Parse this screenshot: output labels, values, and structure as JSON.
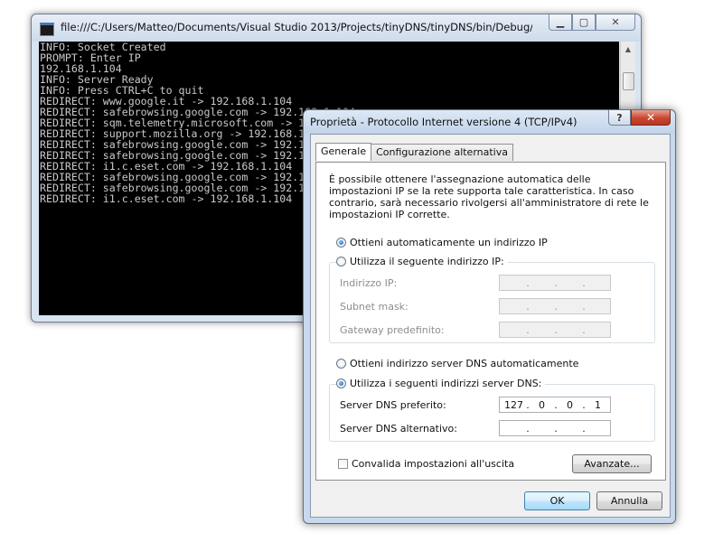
{
  "console": {
    "title": "file:///C:/Users/Matteo/Documents/Visual Studio 2013/Projects/tinyDNS/tinyDNS/bin/Debug/tiny...",
    "minimize_icon": "minimize-icon",
    "maximize_icon": "maximize-icon",
    "close_icon": "close-icon",
    "lines": [
      "INFO: Socket Created",
      "PROMPT: Enter IP",
      "192.168.1.104",
      "INFO: Server Ready",
      "INFO: Press CTRL+C to quit",
      "REDIRECT: www.google.it -> 192.168.1.104",
      "REDIRECT: safebrowsing.google.com -> 192.168.1.104",
      "REDIRECT: sqm.telemetry.microsoft.com -> 192.168.1.104",
      "REDIRECT: support.mozilla.org -> 192.168.1.104",
      "REDIRECT: safebrowsing.google.com -> 192.168.1.104",
      "REDIRECT: safebrowsing.google.com -> 192.168.1.104",
      "REDIRECT: i1.c.eset.com -> 192.168.1.104",
      "REDIRECT: safebrowsing.google.com -> 192.168.1.104",
      "REDIRECT: safebrowsing.google.com -> 192.168.1.104",
      "REDIRECT: i1.c.eset.com -> 192.168.1.104"
    ]
  },
  "dialog": {
    "title": "Proprietà - Protocollo Internet versione 4 (TCP/IPv4)",
    "help_label": "?",
    "close_label": "✕",
    "tabs": [
      "Generale",
      "Configurazione alternativa"
    ],
    "description": "È possibile ottenere l'assegnazione automatica delle impostazioni IP se la rete supporta tale caratteristica. In caso contrario, sarà necessario rivolgersi all'amministratore di rete le impostazioni IP corrette.",
    "ip_auto_label": "Ottieni automaticamente un indirizzo IP",
    "ip_manual_label": "Utilizza il seguente indirizzo IP:",
    "ip_address_label": "Indirizzo IP:",
    "subnet_label": "Subnet mask:",
    "gateway_label": "Gateway predefinito:",
    "dns_auto_label": "Ottieni indirizzo server DNS automaticamente",
    "dns_manual_label": "Utilizza i seguenti indirizzi server DNS:",
    "dns_preferred_label": "Server DNS preferito:",
    "dns_preferred_value": [
      "127",
      "0",
      "0",
      "1"
    ],
    "dns_alternate_label": "Server DNS alternativo:",
    "validate_label": "Convalida impostazioni all'uscita",
    "advanced_button": "Avanzate...",
    "ok_button": "OK",
    "cancel_button": "Annulla",
    "ip_auto_selected": true,
    "dns_manual_selected": true,
    "validate_checked": false
  }
}
